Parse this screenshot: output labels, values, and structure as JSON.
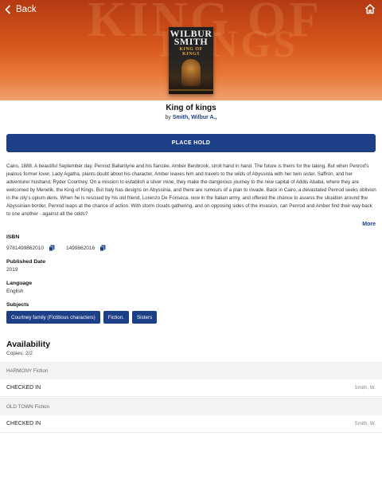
{
  "nav": {
    "back_label": "Back"
  },
  "cover": {
    "author": "WILBUR SMITH",
    "author_line1": "WILBUR",
    "author_line2": "SMITH",
    "title_line1": "KING OF",
    "title_line2": "KINGS"
  },
  "book": {
    "title": "King of kings",
    "by_prefix": "by",
    "author": "Smith, Wilbur A.,"
  },
  "actions": {
    "place_hold": "PLACE HOLD"
  },
  "description": "Cairo, 1888. A beautiful September day. Penrod Ballantyne and his fiancée, Amber Benbrook, stroll hand in hand. The future is theirs for the taking. But when Penrod's jealous former lover, Lady Agatha, plants doubt about his character, Amber leaves him and travels to the wilds of Abyssinia with her twin sister, Saffron, and her adventurer husband, Ryder Courtney. On a mission to establish a silver mine, they make the dangerous journey to the new capital of Addis Ababa, where they are welcomed by Menelik, the King of Kings. But Italy has designs on Abyssinia, and there are rumours of a plan to invade. Back in Cairo, a devastated Penrod seeks oblivion in the city's opium dens. When he is rescued by his old friend, Lorenzo De Fonseca, now in the Italian army, and offered the chance to assess the situation around the Abyssinian border, Penrod leaps at the chance of action. With storm clouds gathering, and on opposing sides of the invasion, can Penrod and Amber find their way back to one another - against all the odds?",
  "more_label": "More",
  "details": {
    "isbn_label": "ISBN",
    "isbns": [
      "9781499862010",
      "1499862016"
    ],
    "published_label": "Published Date",
    "published": "2019",
    "language_label": "Language",
    "language": "English",
    "subjects_label": "Subjects",
    "subjects": [
      "Courtney family (Fictitious characters)",
      "Fiction.",
      "Sisters"
    ]
  },
  "availability": {
    "title": "Availability",
    "copies": "Copies: 2/2",
    "locations": [
      {
        "name": "HARMONY Fiction",
        "status": "CHECKED IN",
        "call": "Smith, W."
      },
      {
        "name": "OLD TOWN Fiction",
        "status": "CHECKED IN",
        "call": "Smith, W."
      }
    ]
  },
  "colors": {
    "accent": "#1d3f87",
    "hero": "#d7561c"
  },
  "icons": {
    "back": "chevron-left-icon",
    "home": "home-icon",
    "copy": "copy-icon"
  }
}
